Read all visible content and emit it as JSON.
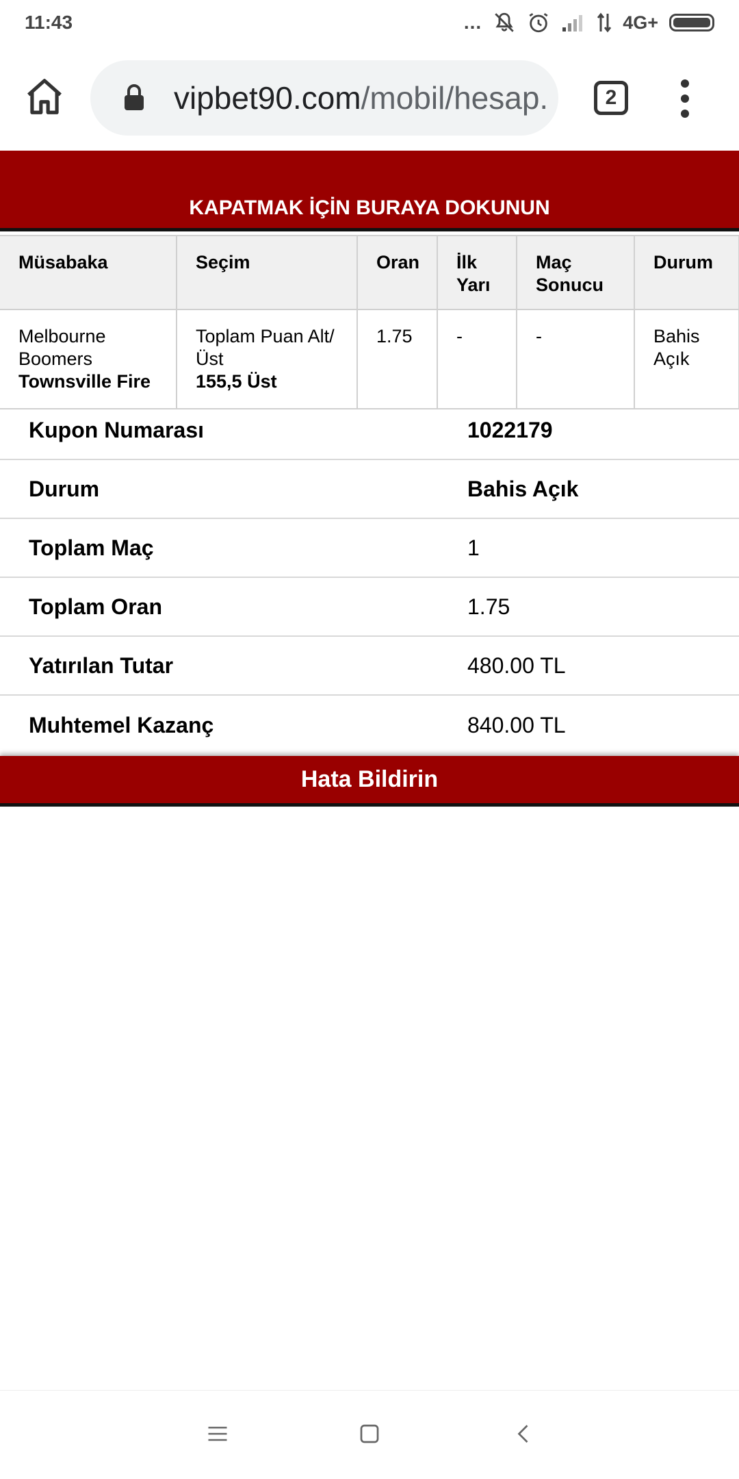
{
  "status_bar": {
    "time": "11:43",
    "dots": "...",
    "network": "4G+",
    "icons": [
      "mute-icon",
      "alarm-icon",
      "signal-icon",
      "data-arrows-icon",
      "battery-icon"
    ]
  },
  "browser": {
    "url_domain": "vipbet90.com",
    "url_path": "/mobil/hesap.",
    "tab_count": "2",
    "icons": [
      "home-icon",
      "lock-icon",
      "tabs-icon",
      "overflow-menu-icon"
    ]
  },
  "banner": {
    "close_label": "KAPATMAK İÇİN BURAYA DOKUNUN"
  },
  "match_table": {
    "headers": [
      "Müsabaka",
      "Seçim",
      "Oran",
      "İlk Yarı",
      "Maç Sonucu",
      "Durum"
    ],
    "rows": [
      {
        "home_team": "Melbourne Boomers",
        "away_team": "Townsville Fire",
        "selection_market": "Toplam Puan Alt/Üst",
        "selection_pick": "155,5 Üst",
        "odds": "1.75",
        "first_half": "-",
        "full_time": "-",
        "status": "Bahis Açık"
      }
    ]
  },
  "summary": {
    "rows": [
      {
        "label": "Kupon Numarası",
        "value": "1022179"
      },
      {
        "label": "Durum",
        "value": "Bahis Açık"
      },
      {
        "label": "Toplam Maç",
        "value": "1"
      },
      {
        "label": "Toplam Oran",
        "value": "1.75"
      },
      {
        "label": "Yatırılan Tutar",
        "value": "480.00 TL"
      },
      {
        "label": "Muhtemel Kazanç",
        "value": "840.00 TL"
      }
    ]
  },
  "report": {
    "label": "Hata Bildirin"
  },
  "nav": {
    "icons": [
      "recents-icon",
      "home-square-icon",
      "back-icon"
    ]
  },
  "colors": {
    "brand_red": "#990000",
    "header_gray": "#f0f0f0",
    "url_bg": "#f1f3f4"
  }
}
